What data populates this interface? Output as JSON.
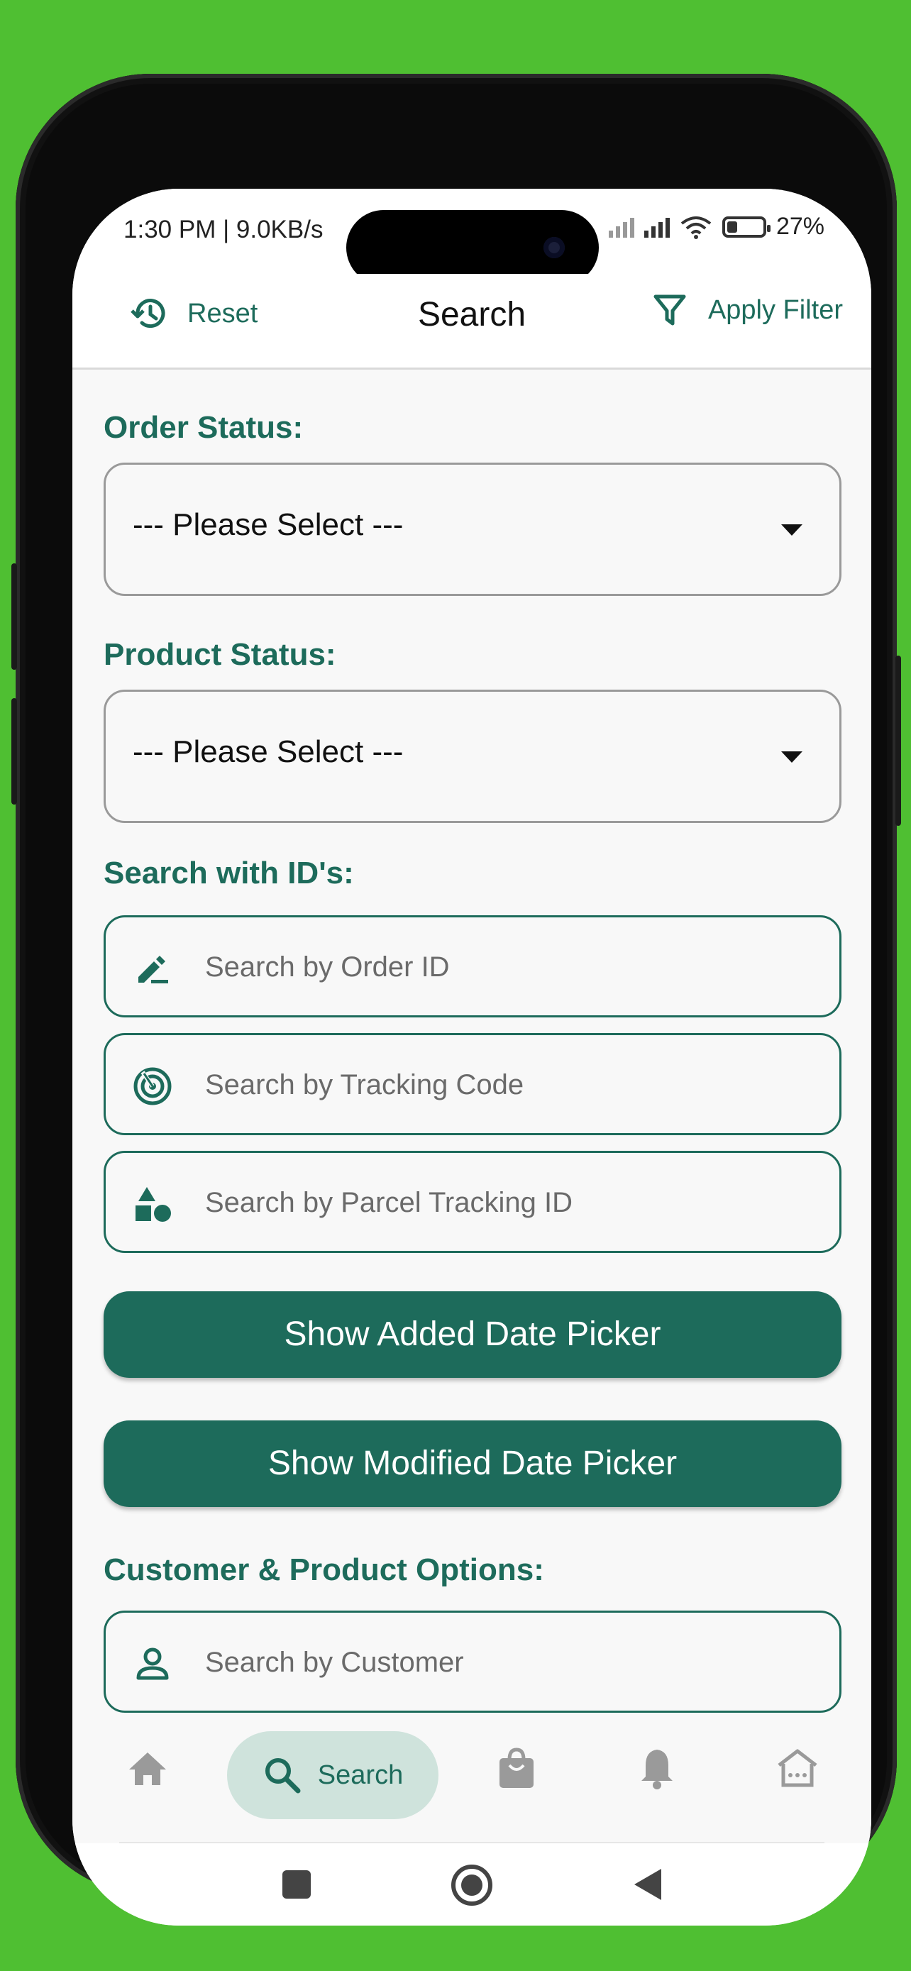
{
  "status_bar": {
    "time": "1:30 PM | 9.0KB/s",
    "battery": "27%"
  },
  "header": {
    "reset_label": "Reset",
    "title": "Search",
    "apply_label": "Apply Filter"
  },
  "order_status": {
    "label": "Order Status:",
    "value": "--- Please Select ---"
  },
  "product_status": {
    "label": "Product Status:",
    "value": "--- Please Select ---"
  },
  "ids": {
    "label": "Search with ID's:",
    "order_placeholder": "Search by Order ID",
    "tracking_placeholder": "Search by Tracking Code",
    "parcel_placeholder": "Search by Parcel Tracking ID"
  },
  "buttons": {
    "added_date": "Show Added Date Picker",
    "modified_date": "Show Modified Date Picker"
  },
  "customer": {
    "label": "Customer & Product Options:",
    "customer_placeholder": "Search by Customer"
  },
  "bottom_nav": {
    "active_label": "Search",
    "items": [
      "home-icon",
      "search-icon",
      "shopping-bag-icon",
      "bell-icon",
      "store-icon"
    ]
  },
  "colors": {
    "accent": "#1d6b5b",
    "pill": "#cfe3dc",
    "background": "#4fbf32"
  }
}
